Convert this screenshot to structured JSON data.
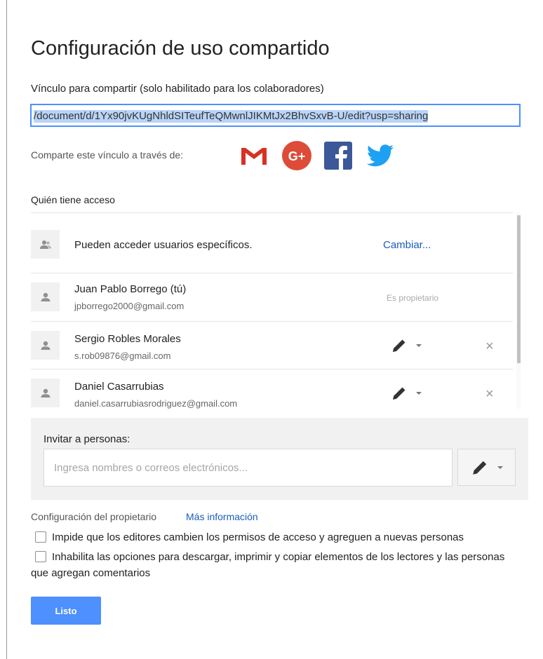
{
  "dialog": {
    "title": "Configuración de uso compartido"
  },
  "share_link": {
    "label": "Vínculo para compartir (solo habilitado para los colaboradores)",
    "value": "/document/d/1Yx90jvKUgNhldSITeufTeQMwnlJIKMtJx2BhvSxvB-U/edit?usp=sharing",
    "share_via_label": "Comparte este vínculo a través de:",
    "social_icons": [
      "gmail-icon",
      "google-plus-icon",
      "facebook-icon",
      "twitter-icon"
    ],
    "colors": {
      "gmail": "#d93025",
      "google_plus": "#dd4b39",
      "facebook": "#3b5998",
      "twitter": "#1da1f2"
    }
  },
  "access": {
    "label": "Quién tiene acceso",
    "general": {
      "text": "Pueden acceder usuarios específicos.",
      "change_label": "Cambiar..."
    },
    "people": [
      {
        "name": "Juan Pablo Borrego (tú)",
        "email": "jpborrego2000@gmail.com",
        "role": "Es propietario"
      },
      {
        "name": "Sergio Robles Morales",
        "email": "s.rob09876@gmail.com",
        "permission_icon": "pencil-icon",
        "remove": "×"
      },
      {
        "name": "Daniel Casarrubias",
        "email": "daniel.casarrubiasrodriguez@gmail.com",
        "permission_icon": "pencil-icon",
        "remove": "×"
      }
    ]
  },
  "invite": {
    "label": "Invitar a personas:",
    "placeholder": "Ingresa nombres o correos electrónicos...",
    "value": ""
  },
  "owner_settings": {
    "label": "Configuración del propietario",
    "more_info": "Más información",
    "options": [
      {
        "text": "Impide que los editores cambien los permisos de acceso y agreguen a nuevas personas",
        "checked": false
      },
      {
        "text": "Inhabilita las opciones para descargar, imprimir y copiar elementos de los lectores y las personas que agregan comentarios",
        "checked": false
      }
    ]
  },
  "footer": {
    "done_label": "Listo",
    "accent_color": "#4d90fe"
  }
}
